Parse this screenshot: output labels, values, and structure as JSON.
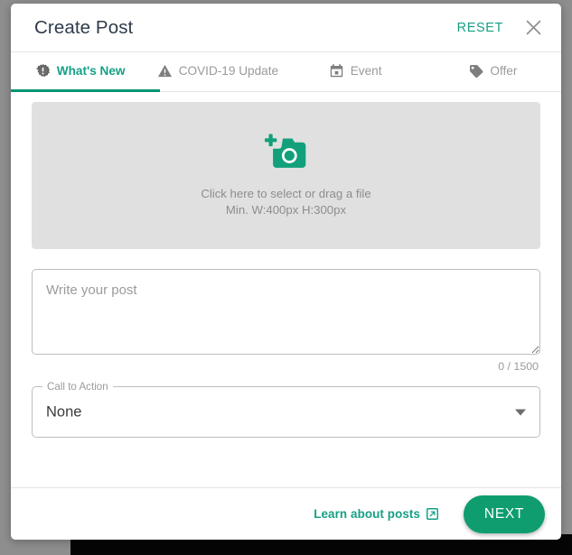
{
  "dialog": {
    "title": "Create Post",
    "reset_label": "RESET",
    "close_icon": "close-icon"
  },
  "tabs": [
    {
      "label": "What's New",
      "icon": "badge-exclamation-icon",
      "active": true
    },
    {
      "label": "COVID-19 Update",
      "icon": "warning-triangle-icon",
      "active": false
    },
    {
      "label": "Event",
      "icon": "calendar-icon",
      "active": false
    },
    {
      "label": "Offer",
      "icon": "price-tag-icon",
      "active": false
    }
  ],
  "dropzone": {
    "icon": "add-photo-icon",
    "primary_text": "Click here to select or drag a file",
    "secondary_text": "Min. W:400px H:300px"
  },
  "post": {
    "placeholder": "Write your post",
    "value": "",
    "counter": "0 / 1500"
  },
  "call_to_action": {
    "legend": "Call to Action",
    "selected": "None",
    "arrow_icon": "chevron-down-icon"
  },
  "footer": {
    "learn_label": "Learn about posts",
    "learn_icon": "external-link-icon",
    "next_label": "NEXT"
  },
  "colors": {
    "accent_green": "#16a085",
    "button_green": "#0f9d6f",
    "underline_green": "#009472",
    "title_navy": "#2e3b4b",
    "dropzone_gray": "#e0e0e0",
    "muted_text": "#9b9b9b"
  }
}
